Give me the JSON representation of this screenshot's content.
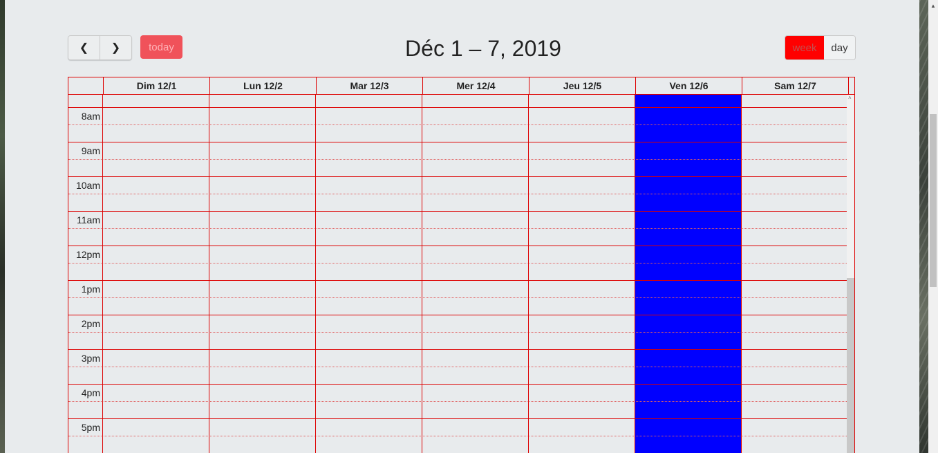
{
  "toolbar": {
    "prev_icon": "chevron-left-icon",
    "next_icon": "chevron-right-icon",
    "prev_glyph": "❮",
    "next_glyph": "❯",
    "today_label": "today",
    "title": "Déc 1 – 7, 2019",
    "week_label": "week",
    "day_label": "day"
  },
  "calendar": {
    "days": [
      {
        "label": "Dim 12/1"
      },
      {
        "label": "Lun 12/2"
      },
      {
        "label": "Mar 12/3"
      },
      {
        "label": "Mer 12/4"
      },
      {
        "label": "Jeu 12/5"
      },
      {
        "label": "Ven 12/6"
      },
      {
        "label": "Sam 12/7"
      }
    ],
    "today_index": 5,
    "today_color": "#0000ff",
    "grid_color": "#dd0000",
    "hours": [
      "8am",
      "9am",
      "10am",
      "11am",
      "12pm",
      "1pm",
      "2pm",
      "3pm",
      "4pm",
      "5pm"
    ]
  },
  "colors": {
    "today_button": "#f0525a",
    "active_view": "#ff0000"
  }
}
